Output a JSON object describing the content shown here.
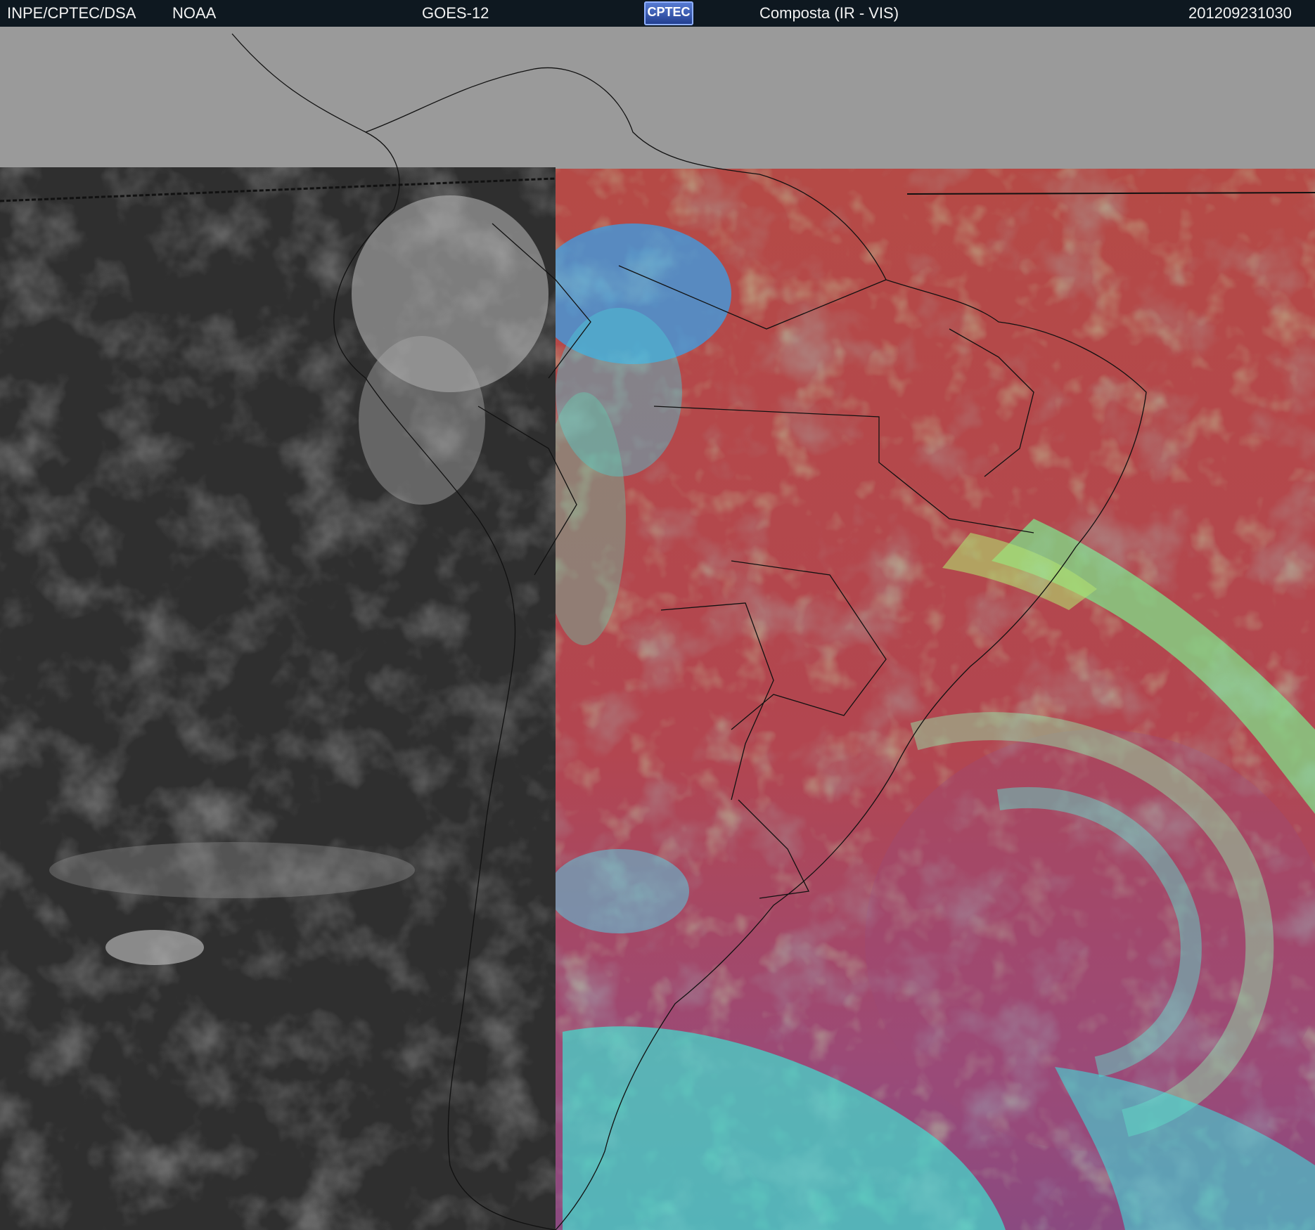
{
  "header": {
    "organization": "INPE/CPTEC/DSA",
    "agency": "NOAA",
    "satellite": "GOES-12",
    "logo_text": "CPTEC",
    "product": "Composta (IR - VIS)",
    "timestamp": "201209231030"
  },
  "map": {
    "region": "South America",
    "no_data_color": "#9a9a9a",
    "ir_palette": [
      "#2a2a2a",
      "#9a9a9a"
    ],
    "composite_palette": [
      "#b54a46",
      "#9a4a78",
      "#7fcf6e",
      "#3fe0d0",
      "#3aa0e8"
    ]
  }
}
